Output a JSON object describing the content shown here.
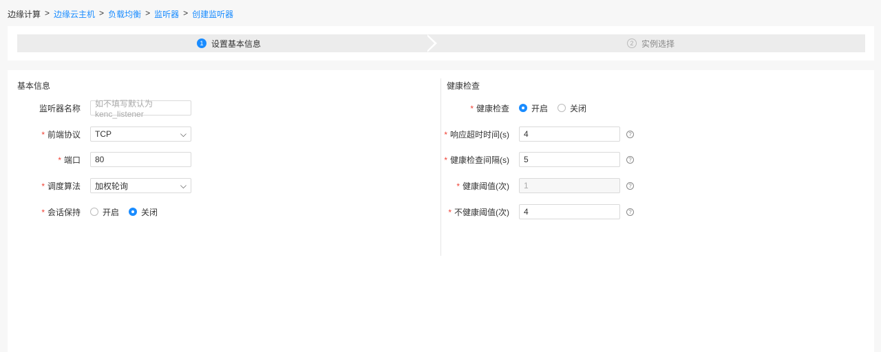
{
  "breadcrumb": [
    "边缘计算",
    "边缘云主机",
    "负载均衡",
    "监听器",
    "创建监听器"
  ],
  "steps": [
    {
      "num": "1",
      "label": "设置基本信息"
    },
    {
      "num": "2",
      "label": "实例选择"
    }
  ],
  "basic": {
    "title": "基本信息",
    "name_label": "监听器名称",
    "name_placeholder": "如不填写默认为kenc_listener",
    "protocol_label": "前端协议",
    "protocol_value": "TCP",
    "port_label": "端口",
    "port_value": "80",
    "algo_label": "调度算法",
    "algo_value": "加权轮询",
    "session_label": "会话保持",
    "on": "开启",
    "off": "关闭"
  },
  "health": {
    "title": "健康检查",
    "check_label": "健康检查",
    "on": "开启",
    "off": "关闭",
    "timeout_label": "响应超时时间(s)",
    "timeout_value": "4",
    "interval_label": "健康检查间隔(s)",
    "interval_value": "5",
    "healthy_label": "健康阈值(次)",
    "healthy_value": "1",
    "unhealthy_label": "不健康阈值(次)",
    "unhealthy_value": "4",
    "help": "?"
  },
  "colors": {
    "accent": "#1a8cff"
  }
}
